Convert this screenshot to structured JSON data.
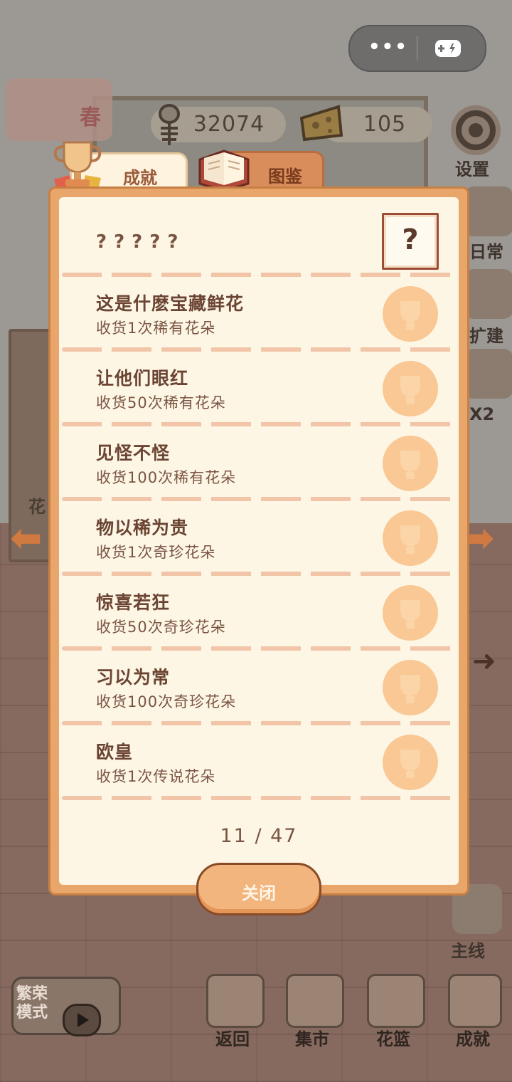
{
  "hud": {
    "season": "春",
    "fish_count": "32074",
    "cheese_count": "105"
  },
  "side_menu": {
    "settings": "设置",
    "daily": "日常",
    "build": "扩建",
    "double": "X2",
    "main_quest": "主线",
    "flower_tag": "花"
  },
  "tabs": {
    "achievements": "成就",
    "album": "图鉴"
  },
  "achievements": [
    {
      "title": "?????",
      "desc": "",
      "hidden": true
    },
    {
      "title": "这是什麽宝藏鲜花",
      "desc": "收货1次稀有花朵"
    },
    {
      "title": "让他们眼红",
      "desc": "收货50次稀有花朵"
    },
    {
      "title": "见怪不怪",
      "desc": "收货100次稀有花朵"
    },
    {
      "title": "物以稀为贵",
      "desc": "收货1次奇珍花朵"
    },
    {
      "title": "惊喜若狂",
      "desc": "收货50次奇珍花朵"
    },
    {
      "title": "习以为常",
      "desc": "收货100次奇珍花朵"
    },
    {
      "title": "欧皇",
      "desc": "收货1次传说花朵"
    }
  ],
  "progress": {
    "text": "11 / 47",
    "unlocked": 11,
    "total": 47
  },
  "close_label": "关闭",
  "bottom_bar": {
    "mode": "繁荣模式",
    "back": "返回",
    "market": "集市",
    "basket": "花篮",
    "achievements": "成就"
  },
  "colors": {
    "panel_border": "#e9a66b",
    "panel_bg": "#fdf6e4",
    "text_brown": "#6b4433",
    "medal_locked": "#f9c894",
    "accent_orange": "#d07940"
  }
}
